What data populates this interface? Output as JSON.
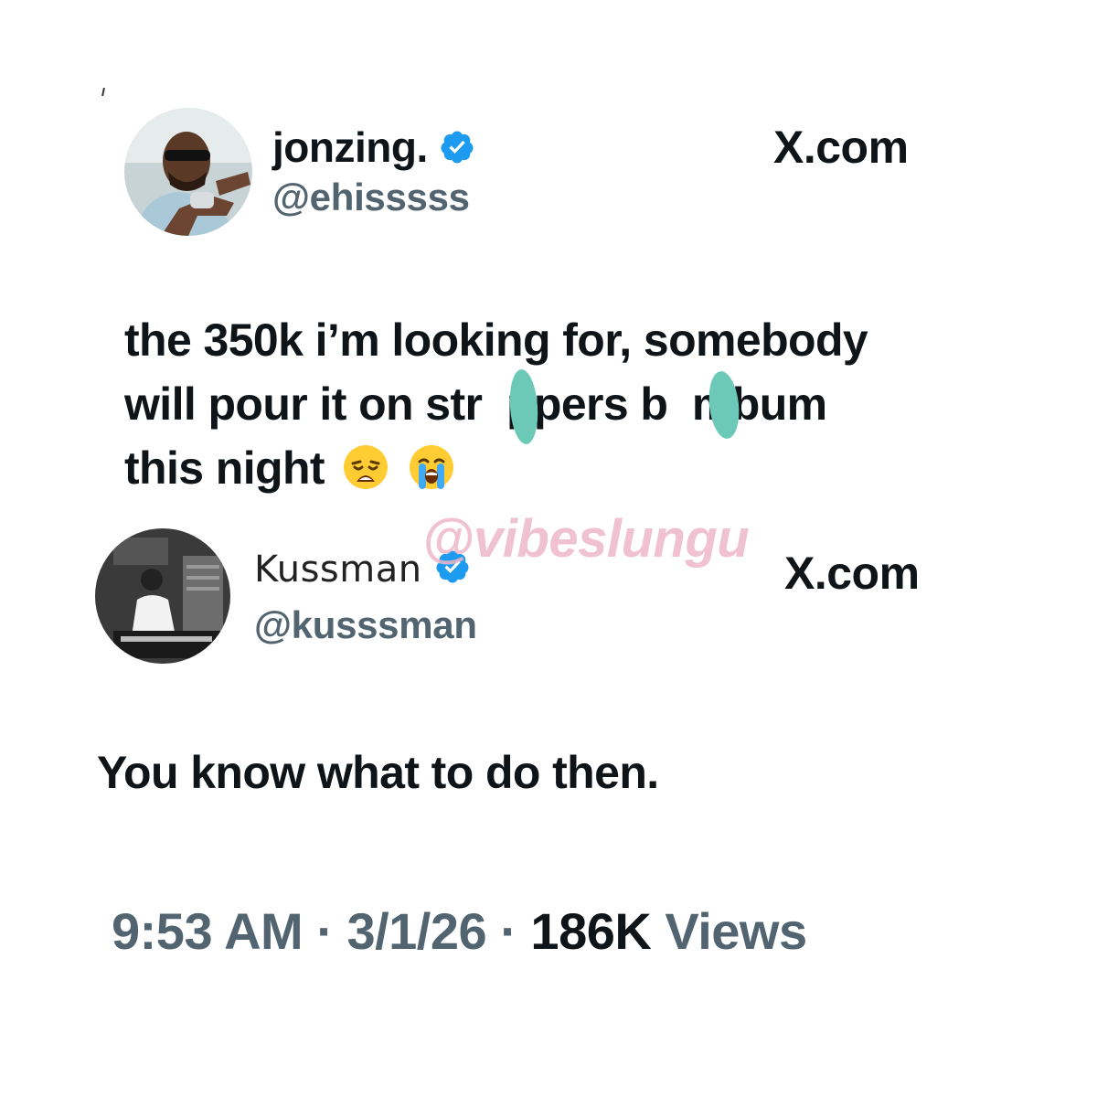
{
  "original_tweet": {
    "author_name": "jonzing.",
    "author_handle": "@ehisssss",
    "source_label": "X.com",
    "text_lines": [
      "the 350k i’m looking for, somebody",
      "will pour it on str  ppers b  mbum",
      "this night"
    ],
    "emojis": [
      "weary-face",
      "loudly-crying-face"
    ]
  },
  "reply_tweet": {
    "author_name": "Kussman",
    "author_handle": "@kusssman",
    "source_label": "X.com",
    "text": "You know what to do then."
  },
  "watermark": "@vibeslungu",
  "meta": {
    "time": "9:53 AM",
    "separator": "·",
    "date": "3/1/26",
    "views_count": "186K",
    "views_label": "Views"
  },
  "colors": {
    "verified_badge": "#1d9bf0",
    "secondary_text": "#536471",
    "censor_blot": "#6cc9b8",
    "watermark": "#eeb7c8"
  }
}
